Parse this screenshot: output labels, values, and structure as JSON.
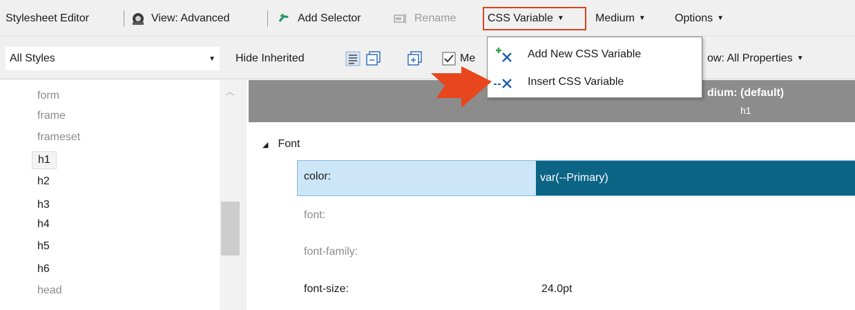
{
  "toolbar1": {
    "stylesheet_editor": "Stylesheet Editor",
    "view": "View: Advanced",
    "add_selector": "Add Selector",
    "rename": "Rename",
    "css_variable": "CSS Variable",
    "medium": "Medium",
    "options": "Options"
  },
  "toolbar2": {
    "styles_filter": "All Styles",
    "hide_inherited": "Hide Inherited",
    "medium_checkbox_partial": "Me",
    "show_partial": "ow: All Properties"
  },
  "css_variable_menu": {
    "items": [
      {
        "label": "Add New CSS Variable",
        "icon": "add-variable-icon"
      },
      {
        "label": "Insert CSS Variable",
        "icon": "insert-variable-icon"
      }
    ]
  },
  "style_list": {
    "items": [
      {
        "label": "form",
        "style": "inherited"
      },
      {
        "label": "frame",
        "style": "inherited"
      },
      {
        "label": "frameset",
        "style": "inherited"
      },
      {
        "label": "h1",
        "style": "selected"
      },
      {
        "label": "h2",
        "style": "defined"
      },
      {
        "label": "h3",
        "style": "defined"
      },
      {
        "label": "h4",
        "style": "defined"
      },
      {
        "label": "h5",
        "style": "defined"
      },
      {
        "label": "h6",
        "style": "defined"
      },
      {
        "label": "head",
        "style": "inherited"
      }
    ]
  },
  "properties": {
    "header_medium": "dium: (default)",
    "header_selector": "h1",
    "group": "Font",
    "rows": [
      {
        "name": "color:",
        "value": "var(--Primary)",
        "style": "selected"
      },
      {
        "name": "font:",
        "value": "",
        "style": "inherited"
      },
      {
        "name": "font-family:",
        "value": "",
        "style": "inherited"
      },
      {
        "name": "font-size:",
        "value": "24.0pt",
        "style": "defined"
      }
    ]
  },
  "colors": {
    "highlight_box": "#d9431e",
    "callout_arrow": "#e8461e",
    "selected_value_bg": "#0d6586",
    "selected_row_bg": "#cde6f7"
  }
}
